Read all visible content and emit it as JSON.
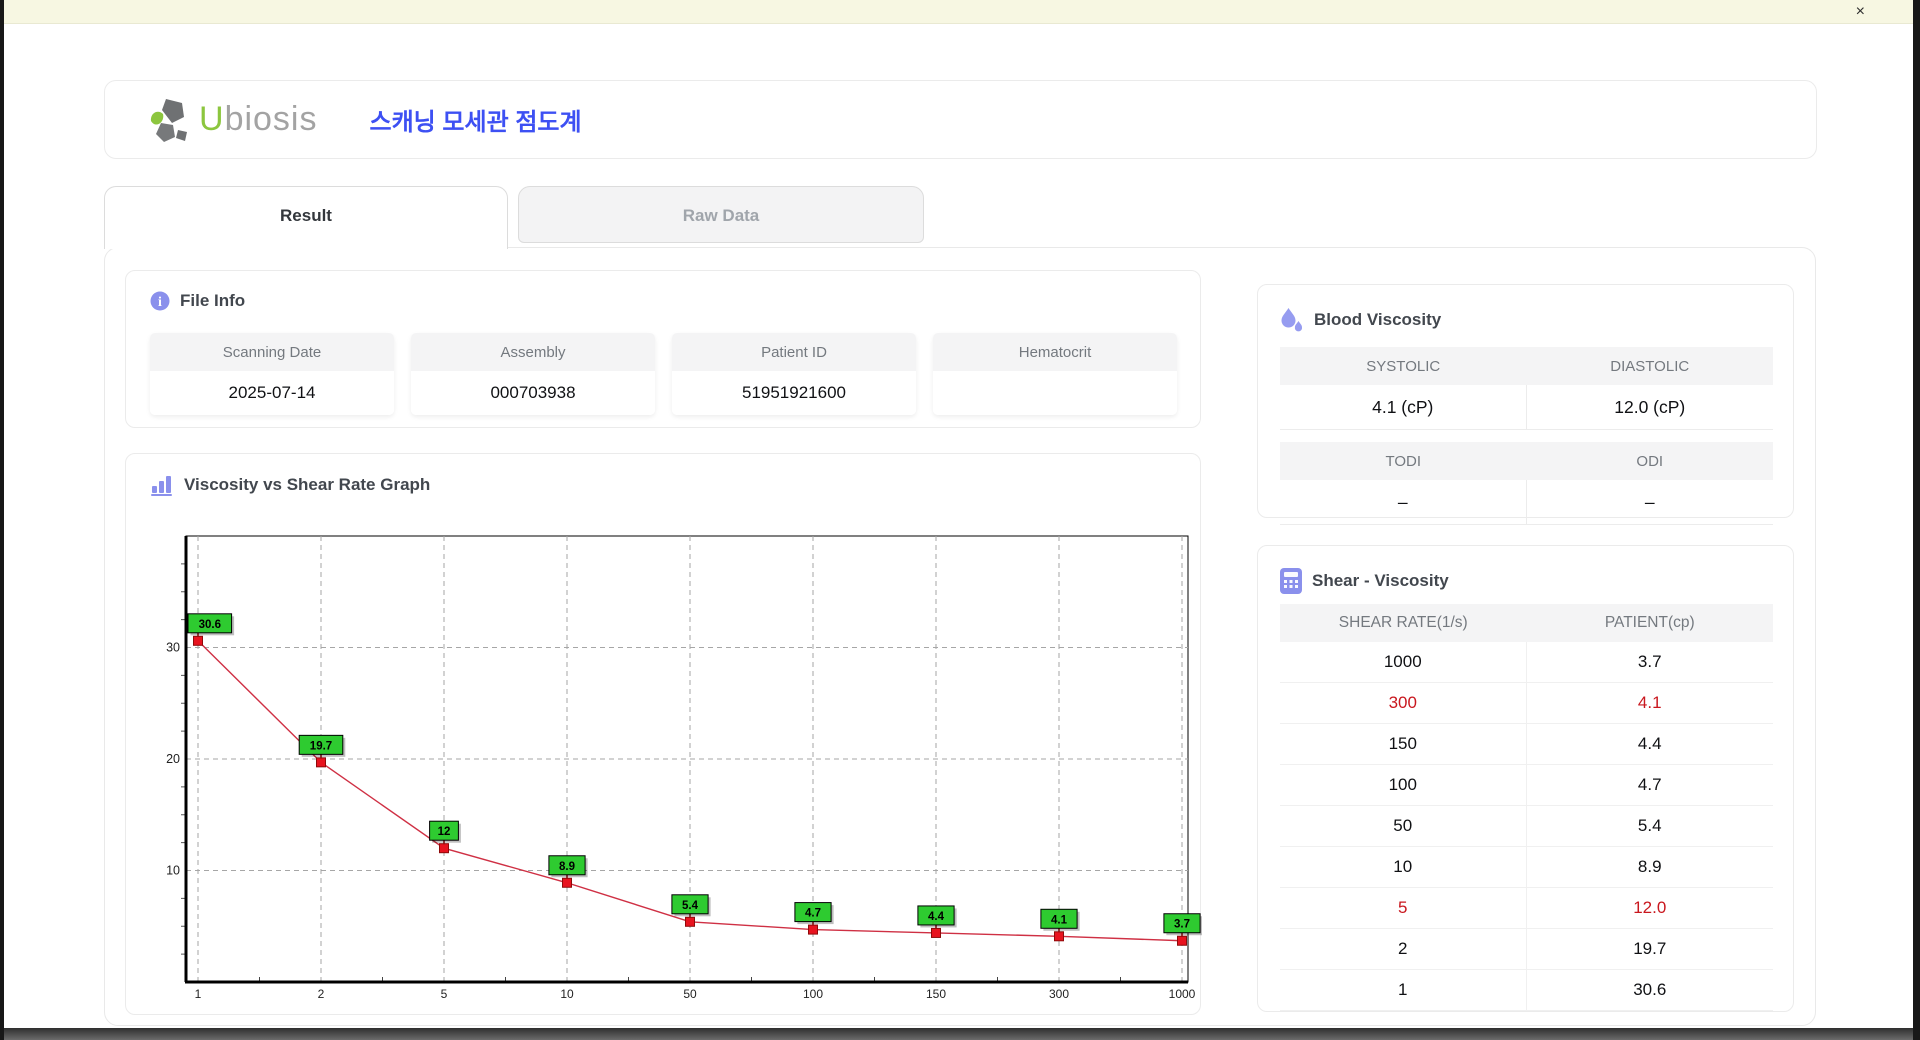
{
  "window": {
    "close_label": "×"
  },
  "header": {
    "brand_u": "U",
    "brand_rest": "biosis",
    "app_title": "스캐닝 모세관 점도계"
  },
  "tabs": [
    {
      "label": "Result",
      "active": true
    },
    {
      "label": "Raw Data",
      "active": false
    }
  ],
  "file_info": {
    "title": "File Info",
    "fields": [
      {
        "label": "Scanning Date",
        "value": "2025-07-14"
      },
      {
        "label": "Assembly",
        "value": "000703938"
      },
      {
        "label": "Patient ID",
        "value": "51951921600"
      },
      {
        "label": "Hematocrit",
        "value": ""
      }
    ]
  },
  "blood_viscosity": {
    "title": "Blood Viscosity",
    "row1": {
      "headers": [
        "SYSTOLIC",
        "DIASTOLIC"
      ],
      "values": [
        "4.1 (cP)",
        "12.0 (cP)"
      ]
    },
    "row2": {
      "headers": [
        "TODI",
        "ODI"
      ],
      "values": [
        "–",
        "–"
      ]
    }
  },
  "shear_viscosity": {
    "title": "Shear - Viscosity",
    "columns": [
      "SHEAR RATE(1/s)",
      "PATIENT(cp)"
    ],
    "rows": [
      {
        "shear": "1000",
        "patient": "3.7",
        "highlight": false
      },
      {
        "shear": "300",
        "patient": "4.1",
        "highlight": true
      },
      {
        "shear": "150",
        "patient": "4.4",
        "highlight": false
      },
      {
        "shear": "100",
        "patient": "4.7",
        "highlight": false
      },
      {
        "shear": "50",
        "patient": "5.4",
        "highlight": false
      },
      {
        "shear": "10",
        "patient": "8.9",
        "highlight": false
      },
      {
        "shear": "5",
        "patient": "12.0",
        "highlight": true
      },
      {
        "shear": "2",
        "patient": "19.7",
        "highlight": false
      },
      {
        "shear": "1",
        "patient": "30.6",
        "highlight": false
      }
    ]
  },
  "graph": {
    "title": "Viscosity vs Shear Rate Graph"
  },
  "chart_data": {
    "type": "line",
    "title": "Viscosity vs Shear Rate Graph",
    "x_categories": [
      "1",
      "2",
      "5",
      "10",
      "50",
      "100",
      "150",
      "300",
      "1000"
    ],
    "values": [
      30.6,
      19.7,
      12,
      8.9,
      5.4,
      4.7,
      4.4,
      4.1,
      3.7
    ],
    "point_labels": [
      "30.6",
      "19.7",
      "12",
      "8.9",
      "5.4",
      "4.7",
      "4.4",
      "4.1",
      "3.7"
    ],
    "xlabel": "",
    "ylabel": "",
    "ylim": [
      0,
      40
    ],
    "y_ticks": [
      10,
      20,
      30
    ],
    "y_minor_step": 2.5,
    "x_axis_style": "category-spaced (log-like shear rates)",
    "grid": "dashed",
    "legend": "none",
    "line_color": "#cf3044",
    "marker_color": "#e8131f",
    "marker_stroke": "#8e0a0a",
    "label_bg": "#2ecb30",
    "label_border": "#000000",
    "grid_color": "#a6a6a6"
  }
}
